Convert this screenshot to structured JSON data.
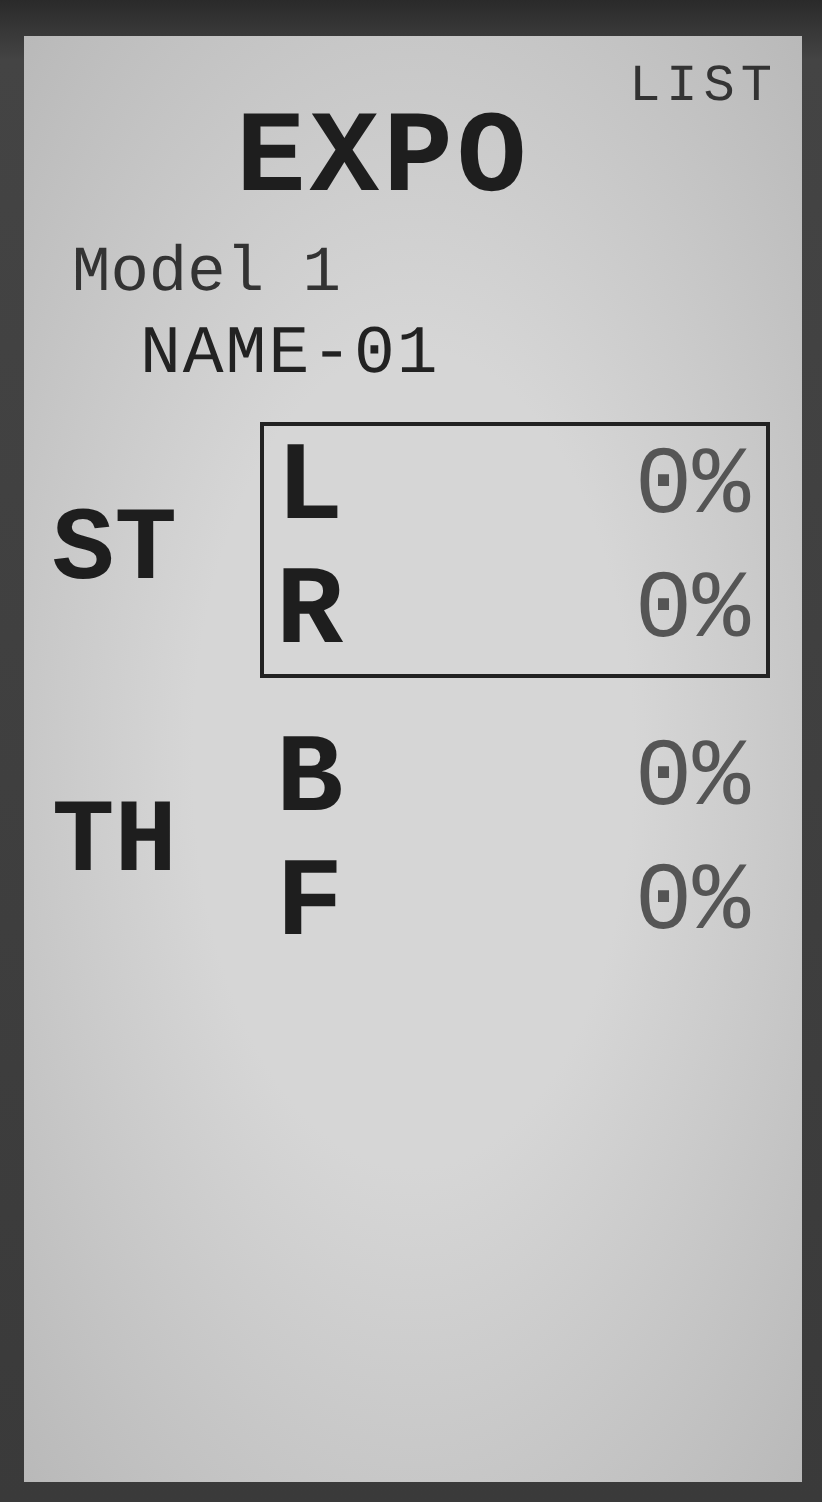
{
  "header": {
    "menu_label": "LIST",
    "title": "EXPO",
    "model": "Model 1",
    "name": "NAME-01"
  },
  "groups": [
    {
      "label": "ST",
      "selected": true,
      "rows": [
        {
          "label": "L",
          "value": "0%"
        },
        {
          "label": "R",
          "value": "0%"
        }
      ]
    },
    {
      "label": "TH",
      "selected": false,
      "rows": [
        {
          "label": "B",
          "value": "0%"
        },
        {
          "label": "F",
          "value": "0%"
        }
      ]
    }
  ]
}
